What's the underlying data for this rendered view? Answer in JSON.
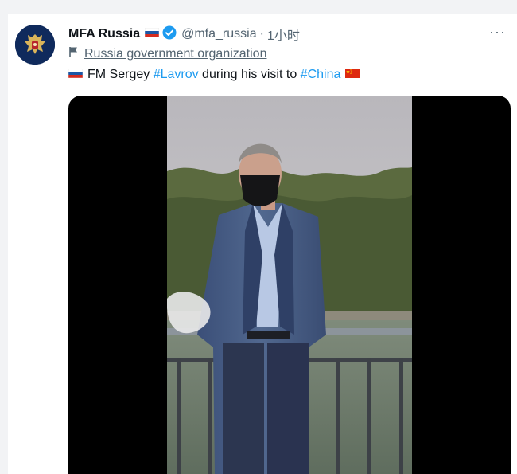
{
  "tweet": {
    "author_name": "MFA Russia",
    "handle": "@mfa_russia",
    "separator": "·",
    "time": "1小时",
    "more_label": "···",
    "label_text": "Russia government organization",
    "text_prefix": "FM Sergey ",
    "hashtag_1": "#Lavrov",
    "text_middle": " during his visit to ",
    "hashtag_2": "#China"
  },
  "icons": {
    "avatar": "russian-coat-of-arms",
    "verified": "verified-badge-icon",
    "label": "flag-outline-icon"
  },
  "colors": {
    "link": "#1d9bf0",
    "text": "#0f1419",
    "muted": "#536471",
    "verified": "#1d9bf0"
  }
}
